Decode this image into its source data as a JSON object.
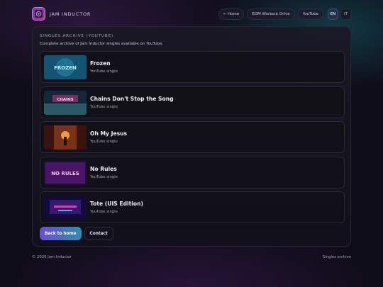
{
  "header": {
    "brand_name": "JAM INDUCTOR",
    "nav": [
      {
        "label": "← Home"
      },
      {
        "label": "EDM Workout Drive"
      },
      {
        "label": "YouTube"
      }
    ],
    "languages": [
      {
        "code": "EN",
        "active": true
      },
      {
        "code": "IT",
        "active": false
      }
    ]
  },
  "main": {
    "eyebrow": "SINGLES ARCHIVE (YOUTUBE)",
    "description": "Complete archive of Jam Inductor singles available on YouTube.",
    "items": [
      {
        "title": "Frozen",
        "subtitle": "YouTube single",
        "thumb_text": "FROZEN",
        "colors": [
          "#1a6a8a",
          "#0f3a58",
          "#6fd0f0"
        ]
      },
      {
        "title": "Chains Don't Stop the Song",
        "subtitle": "YouTube single",
        "thumb_text": "CHAINS",
        "colors": [
          "#2a5a6a",
          "#14283a",
          "#e060a0"
        ]
      },
      {
        "title": "Oh My Jesus",
        "subtitle": "YouTube single",
        "thumb_text": "",
        "colors": [
          "#8a3a1a",
          "#3a140c",
          "#ffb040"
        ]
      },
      {
        "title": "No Rules",
        "subtitle": "YouTube single",
        "thumb_text": "NO RULES",
        "colors": [
          "#5a1a7a",
          "#22103a",
          "#ff60c0"
        ]
      },
      {
        "title": "Tote (UIS Edition)",
        "subtitle": "YouTube single",
        "thumb_text": "",
        "colors": [
          "#3a1a7a",
          "#120c3a",
          "#ff40a0"
        ]
      }
    ],
    "primary_button": "Back to home",
    "secondary_button": "Contact"
  },
  "footer": {
    "copyright": "© 2026 Jam Inductor",
    "right_text": "Singles archive"
  },
  "icons": {
    "logo": "jam-inductor-logo-icon"
  }
}
